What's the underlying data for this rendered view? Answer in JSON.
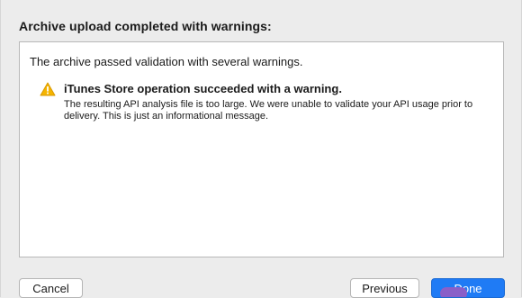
{
  "dialog": {
    "title": "Archive upload completed with warnings:",
    "summary": "The archive passed validation with several warnings.",
    "warnings": [
      {
        "icon": "warning-triangle-icon",
        "title": "iTunes Store operation succeeded with a warning.",
        "message": "The resulting API analysis file is too large.  We were unable to validate your API usage prior to delivery.  This is just an informational message."
      }
    ]
  },
  "buttons": {
    "cancel_label": "Cancel",
    "previous_label": "Previous",
    "done_label": "Done"
  },
  "colors": {
    "accent": "#1f7bf5",
    "warning": "#f5b400"
  }
}
